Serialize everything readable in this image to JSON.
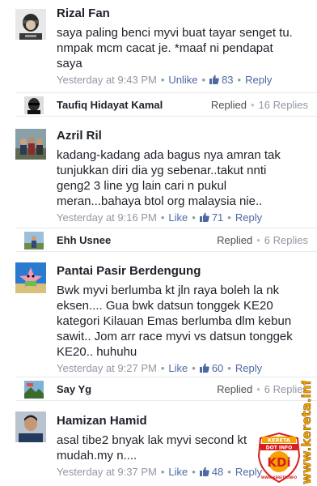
{
  "comments": [
    {
      "author": "Rizal Fan",
      "text": "saya paling benci myvi buat tayar senget tu. nmpak mcm cacat je. *maaf ni pendapat saya",
      "time": "Yesterday at 9:43 PM",
      "action": "Unlike",
      "likes": "83",
      "reply_label": "Reply",
      "avatar_icon": "person-headband-avatar-icon",
      "reply_strip": {
        "name": "Taufiq Hidayat Kamal",
        "status": "Replied",
        "count": "16 Replies",
        "avatar_icon": "sunglasses-avatar-icon"
      }
    },
    {
      "author": "Azril Ril",
      "text": "kadang-kadang ada bagus nya amran tak tunjukkan diri dia yg sebenar..takut nnti geng2 3 line yg lain cari n pukul meran...bahaya btol org malaysia nie..",
      "time": "Yesterday at 9:16 PM",
      "action": "Like",
      "likes": "71",
      "reply_label": "Reply",
      "avatar_icon": "group-photo-avatar-icon",
      "reply_strip": {
        "name": "Ehh Usnee",
        "status": "Replied",
        "count": "6 Replies",
        "avatar_icon": "outdoor-avatar-icon"
      }
    },
    {
      "author": "Pantai Pasir Berdengung",
      "text": "Bwk myvi berlumba kt jln raya boleh la nk eksen.... Gua bwk datsun tonggek KE20 kategori Kilauan Emas berlumba dlm kebun sawit.. Jom arr race myvi vs datsun tonggek KE20.. huhuhu",
      "time": "Yesterday at 9:27 PM",
      "action": "Like",
      "likes": "60",
      "reply_label": "Reply",
      "avatar_icon": "cartoon-starfish-avatar-icon",
      "reply_strip": {
        "name": "Say Yg",
        "status": "Replied",
        "count": "6 Replies",
        "avatar_icon": "scenery-avatar-icon"
      }
    },
    {
      "author": "Hamizan Hamid",
      "text": "asal tibe2 bnyak lak myvi second kt mudah.my n....",
      "time": "Yesterday at 9:37 PM",
      "action": "Like",
      "likes": "48",
      "reply_label": "Reply",
      "avatar_icon": "portrait-avatar-icon"
    }
  ],
  "watermark": {
    "vertical_text": "www.kereta.info",
    "logo_top": "KERETA",
    "logo_mid": "DOT INFO",
    "logo_main": "KDi",
    "logo_bottom": "WWW.KERETA.INFO"
  },
  "colors": {
    "link": "#4e69a2",
    "muted": "#9197a3",
    "text": "#1d2129",
    "watermark_orange": "#f5a300",
    "watermark_red": "#d81e1e"
  }
}
